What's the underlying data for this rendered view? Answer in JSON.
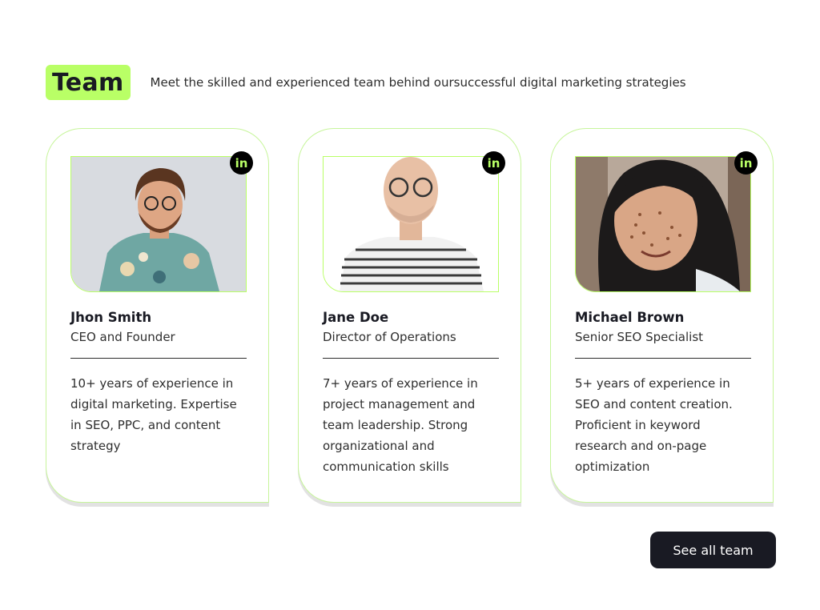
{
  "header": {
    "tag": "Team",
    "subtitle": "Meet the skilled and experienced team behind oursuccessful digital marketing strategies"
  },
  "team": [
    {
      "name": "Jhon Smith",
      "role": "CEO and Founder",
      "bio": "10+ years of experience in digital marketing. Expertise in SEO, PPC, and content strategy",
      "social_icon": "in"
    },
    {
      "name": "Jane Doe",
      "role": "Director of Operations",
      "bio": "7+ years of experience in project management and team leadership. Strong organizational and communication skills",
      "social_icon": "in"
    },
    {
      "name": "Michael Brown",
      "role": "Senior SEO Specialist",
      "bio": "5+ years of experience in SEO and content creation. Proficient in keyword research and on-page optimization",
      "social_icon": "in"
    }
  ],
  "see_all_label": "See all team",
  "colors": {
    "accent": "#b9ff66",
    "dark": "#191a23",
    "border": "#c7f59b"
  }
}
